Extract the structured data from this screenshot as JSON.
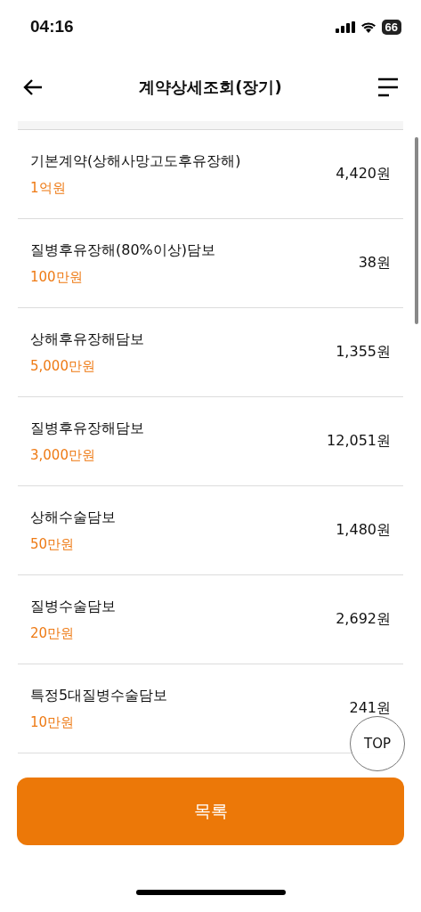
{
  "status_bar": {
    "time": "04:16",
    "battery": "66"
  },
  "header": {
    "title": "계약상세조회(장기)"
  },
  "coverages": [
    {
      "name": "기본계약(상해사망고도후유장해)",
      "amount": "1억원",
      "premium": "4,420원"
    },
    {
      "name": "질병후유장해(80%이상)담보",
      "amount": "100만원",
      "premium": "38원"
    },
    {
      "name": "상해후유장해담보",
      "amount": "5,000만원",
      "premium": "1,355원"
    },
    {
      "name": "질병후유장해담보",
      "amount": "3,000만원",
      "premium": "12,051원"
    },
    {
      "name": "상해수술담보",
      "amount": "50만원",
      "premium": "1,480원"
    },
    {
      "name": "질병수술담보",
      "amount": "20만원",
      "premium": "2,692원"
    },
    {
      "name": "특정5대질병수술담보",
      "amount": "10만원",
      "premium": "241원"
    }
  ],
  "top_button": "TOP",
  "list_button": "목록"
}
